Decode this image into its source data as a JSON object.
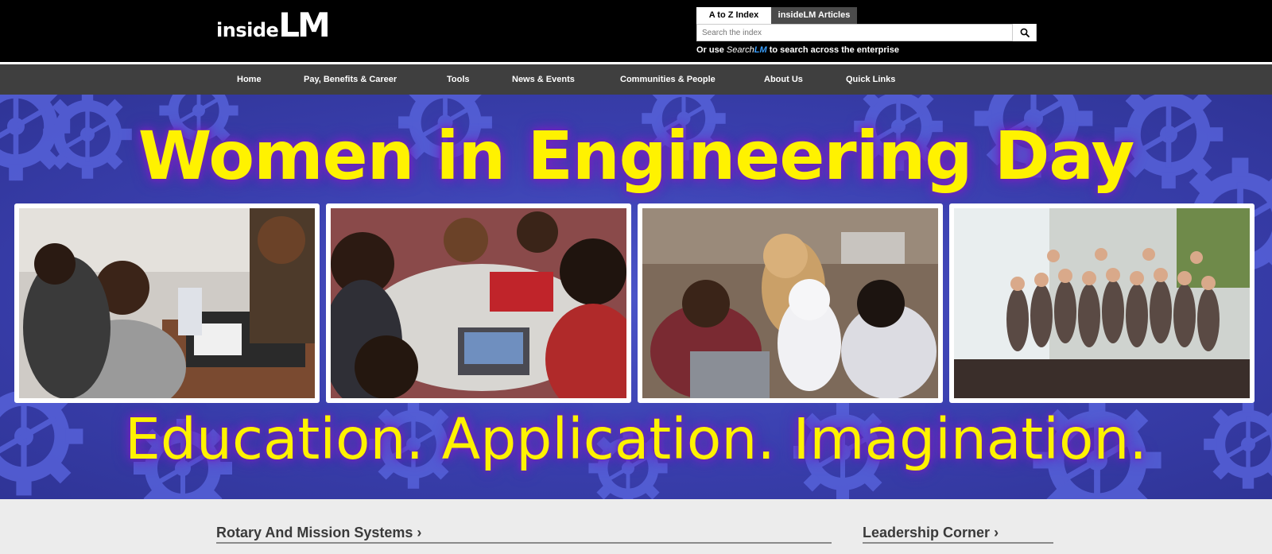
{
  "header": {
    "logo_prefix": "inside",
    "logo_suffix": "LM",
    "tabs": [
      {
        "label": "A to Z Index",
        "active": true
      },
      {
        "label": "insideLM Articles",
        "active": false
      }
    ],
    "search": {
      "placeholder": "Search the index"
    },
    "enterprise_note": {
      "prefix": "Or use ",
      "brand_a": "Search",
      "brand_b": "LM",
      "suffix": " to search across the enterprise"
    }
  },
  "nav": {
    "items": [
      "Home",
      "Pay, Benefits & Career",
      "Tools",
      "News & Events",
      "Communities & People",
      "About Us",
      "Quick Links"
    ]
  },
  "hero": {
    "title": "Women in Engineering Day",
    "subtitle": "Education. Application. Imagination."
  },
  "sections": [
    {
      "title": "Rotary And Mission Systems",
      "chevron": "›"
    },
    {
      "title": "Leadership Corner",
      "chevron": "›"
    }
  ],
  "colors": {
    "accent_yellow": "#fff200",
    "hero_blue": "#3a3fae",
    "nav_gray": "#3f3f3f",
    "header_black": "#000000",
    "brand_blue": "#3aa0ff"
  },
  "icons": {
    "search": "search-icon",
    "chevron": "chevron-right-icon"
  }
}
